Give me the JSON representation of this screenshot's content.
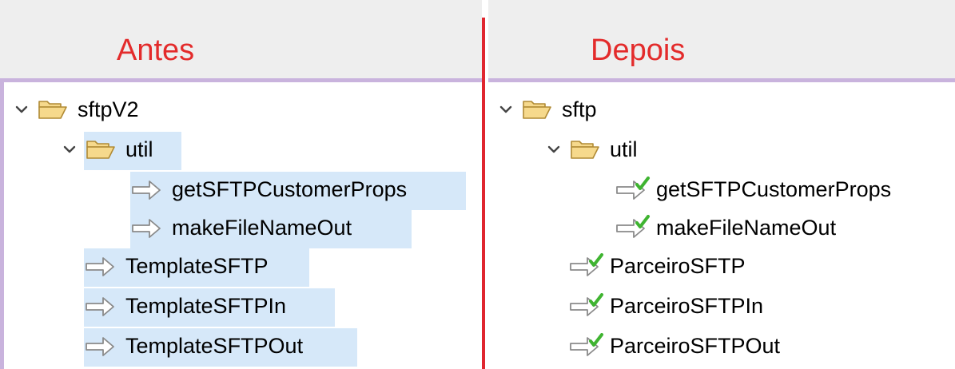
{
  "colors": {
    "label_red": "#e32b2b",
    "separator_red": "#e0262f",
    "selection_blue": "#d6e8f9",
    "header_bg": "#eeeeee",
    "folder_fill": "#f6d98c",
    "folder_stroke": "#b08a34",
    "arrow_stroke": "#8a8a8a",
    "check_green": "#3fb431"
  },
  "before": {
    "label": "Antes",
    "root": {
      "name": "sftpV2",
      "icon": "folder-open-icon",
      "expanded": true
    },
    "folder": {
      "name": "util",
      "icon": "folder-open-icon",
      "expanded": true
    },
    "folder_children": [
      {
        "name": "getSFTPCustomerProps",
        "icon": "service-arrow-icon"
      },
      {
        "name": "makeFileNameOut",
        "icon": "service-arrow-icon"
      }
    ],
    "root_children": [
      {
        "name": "TemplateSFTP",
        "icon": "service-arrow-icon"
      },
      {
        "name": "TemplateSFTPIn",
        "icon": "service-arrow-icon"
      },
      {
        "name": "TemplateSFTPOut",
        "icon": "service-arrow-icon"
      }
    ]
  },
  "after": {
    "label": "Depois",
    "root": {
      "name": "sftp",
      "icon": "folder-open-icon",
      "expanded": true
    },
    "folder": {
      "name": "util",
      "icon": "folder-open-icon",
      "expanded": true
    },
    "folder_children": [
      {
        "name": "getSFTPCustomerProps",
        "icon": "service-checked-icon"
      },
      {
        "name": "makeFileNameOut",
        "icon": "service-checked-icon"
      }
    ],
    "root_children": [
      {
        "name": "ParceiroSFTP",
        "icon": "service-checked-icon"
      },
      {
        "name": "ParceiroSFTPIn",
        "icon": "service-checked-icon"
      },
      {
        "name": "ParceiroSFTPOut",
        "icon": "service-checked-icon"
      }
    ]
  }
}
